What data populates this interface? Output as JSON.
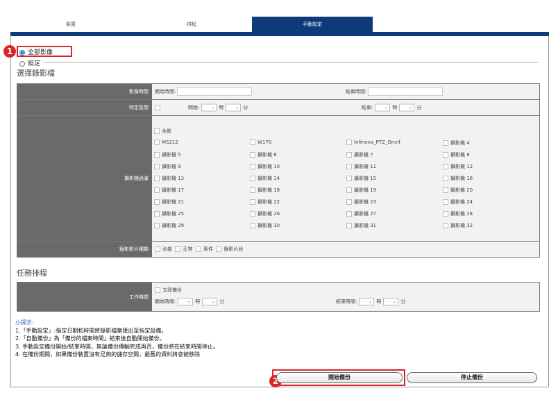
{
  "tabs": [
    "裝置",
    "排程",
    "手動設定"
  ],
  "mode": {
    "all_label": "全部影像",
    "setting_label": "設定"
  },
  "select_title": "選擇錄影檔",
  "rows": {
    "video_time": {
      "label": "影像時間",
      "start": "開始時間:",
      "end": "結束時間:"
    },
    "specific": {
      "label": "特定區間",
      "start": "開始:",
      "end": "結束:",
      "hour": "時",
      "minute": "分"
    },
    "camera_filter": {
      "label": "攝影機過濾",
      "all": "全部"
    },
    "record_type": {
      "label": "錄影影片種類",
      "options": [
        "全部",
        "正常",
        "事件",
        "錄影片段"
      ]
    }
  },
  "cameras": [
    "MS212",
    "W170",
    "Infinova_PTZ_Onvif",
    "攝影機 4",
    "攝影機 5",
    "攝影機 6",
    "攝影機 7",
    "攝影機 8",
    "攝影機 9",
    "攝影機 10",
    "攝影機 11",
    "攝影機 12",
    "攝影機 13",
    "攝影機 14",
    "攝影機 15",
    "攝影機 16",
    "攝影機 17",
    "攝影機 18",
    "攝影機 19",
    "攝影機 20",
    "攝影機 21",
    "攝影機 22",
    "攝影機 23",
    "攝影機 24",
    "攝影機 25",
    "攝影機 26",
    "攝影機 27",
    "攝影機 28",
    "攝影機 29",
    "攝影機 30",
    "攝影機 31",
    "攝影機 32"
  ],
  "task_title": "任務排程",
  "work_time": {
    "label": "工作時間",
    "immediate": "立即備份",
    "start": "開始時間:",
    "end": "結束時間:",
    "hour": "時",
    "minute": "分"
  },
  "tips": {
    "heading": "小提示:",
    "lines": [
      "1.「手動設定」:指定日期和時間將錄影檔案匯出至指定設備。",
      "2.「自動備份」為「備份的檔案時間」結束後自動開始備份。",
      "3. 手動設定備份開始/結束時間，無論備份傳輸完成與否，備份將在結束時間停止。",
      "4. 在備份期間，如果備份裝置沒有足夠的儲存空間，最舊的資料將會被移除"
    ]
  },
  "buttons": {
    "start": "開始備份",
    "stop": "停止備份"
  },
  "markers": [
    "1",
    "2"
  ],
  "colors": {
    "accent": "#0d3b7a",
    "marker": "#d9262a"
  }
}
